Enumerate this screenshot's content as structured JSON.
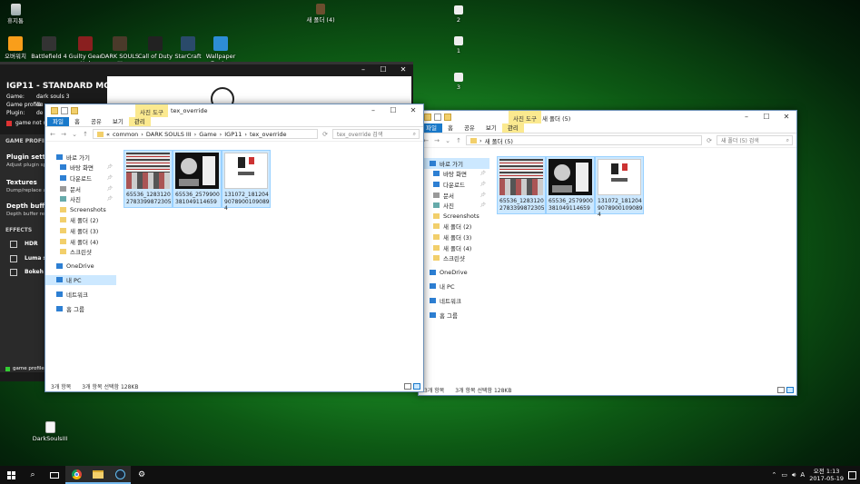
{
  "desktop": {
    "icons_top": [
      {
        "label": "휴지통",
        "icon": "recycle-bin-icon"
      },
      {
        "label": "새 폴더 (4)",
        "icon": "folder-icon"
      },
      {
        "label": "2",
        "icon": "file-icon"
      },
      {
        "label": "1",
        "icon": "file-icon"
      },
      {
        "label": "3",
        "icon": "file-icon"
      }
    ],
    "icons_row2": [
      {
        "label": "오버워치",
        "icon": "overwatch-icon",
        "color": "#f99e1a"
      },
      {
        "label": "Battlefield 4",
        "icon": "battlefield-icon",
        "color": "#333333"
      },
      {
        "label": "Guilty Gear Xrd",
        "icon": "guilty-gear-icon",
        "color": "#8a1f1f"
      },
      {
        "label": "DARK SOULS III",
        "icon": "dark-souls-icon",
        "color": "#4a3a2a"
      },
      {
        "label": "Call of Duty",
        "icon": "call-of-duty-icon",
        "color": "#222222"
      },
      {
        "label": "StarCraft",
        "icon": "starcraft-icon",
        "color": "#2a4a6a"
      },
      {
        "label": "Wallpaper Engine",
        "icon": "wallpaper-engine-icon",
        "color": "#2d8dd6"
      }
    ],
    "bottom_icon": {
      "label": "DarkSoulsIII",
      "icon": "file-icon"
    }
  },
  "igp": {
    "title": "IGP11 - STANDARD MODE",
    "game_label": "Game:",
    "game_value": "dark souls 3",
    "profile_label": "Game profile:",
    "profile_value": "de",
    "plugin_label": "Plugin:",
    "plugin_value": "de",
    "game_status": "game not run",
    "section1": "GAME PROFILE SE",
    "plugin_settings": "Plugin setting",
    "plugin_settings_sub": "Adjust plugin spec",
    "textures": "Textures",
    "textures_sub": "Dump/replace and",
    "depth": "Depth buffer",
    "depth_sub": "Depth buffer rend",
    "effects": "EFFECTS",
    "effect_items": [
      "HDR",
      "Luma s",
      "Bokeh"
    ],
    "footer": "game profile s"
  },
  "explorer_left": {
    "context_tab": "사진 도구",
    "title": "tex_override",
    "tabs": [
      "파일",
      "홈",
      "공유",
      "보기",
      "관리"
    ],
    "breadcrumb": [
      "common",
      "DARK SOULS III",
      "Game",
      "IGP11",
      "tex_override"
    ],
    "search_placeholder": "tex_override 검색",
    "nav": [
      {
        "label": "바로 가기",
        "type": "star",
        "pin": false,
        "sub": false
      },
      {
        "label": "바탕 화면",
        "type": "desktop",
        "pin": true,
        "sub": true
      },
      {
        "label": "다운로드",
        "type": "download",
        "pin": true,
        "sub": true
      },
      {
        "label": "문서",
        "type": "doc",
        "pin": true,
        "sub": true
      },
      {
        "label": "사진",
        "type": "pic",
        "pin": true,
        "sub": true
      },
      {
        "label": "Screenshots",
        "type": "folder",
        "pin": false,
        "sub": true
      },
      {
        "label": "새 폴더 (2)",
        "type": "folder",
        "pin": false,
        "sub": true
      },
      {
        "label": "새 폴더 (3)",
        "type": "folder",
        "pin": false,
        "sub": true
      },
      {
        "label": "새 폴더 (4)",
        "type": "folder",
        "pin": false,
        "sub": true
      },
      {
        "label": "스크린샷",
        "type": "folder",
        "pin": false,
        "sub": true
      },
      {
        "label": "",
        "type": "gap",
        "pin": false,
        "sub": false
      },
      {
        "label": "OneDrive",
        "type": "cloud",
        "pin": false,
        "sub": false
      },
      {
        "label": "",
        "type": "gap",
        "pin": false,
        "sub": false
      },
      {
        "label": "내 PC",
        "type": "pc",
        "pin": false,
        "sub": false,
        "selected": true
      },
      {
        "label": "",
        "type": "gap",
        "pin": false,
        "sub": false
      },
      {
        "label": "네트워크",
        "type": "net",
        "pin": false,
        "sub": false
      },
      {
        "label": "",
        "type": "gap",
        "pin": false,
        "sub": false
      },
      {
        "label": "홈 그룹",
        "type": "home",
        "pin": false,
        "sub": false
      }
    ],
    "files": [
      {
        "name": "65536_12831202783399872305",
        "line1": "65536_1283120",
        "line2": "2783399872305",
        "thumb": "strip"
      },
      {
        "name": "65536_2579900381049114659",
        "line1": "65536_2579900",
        "line2": "381049114659",
        "thumb": "circle"
      },
      {
        "name": "131072_1812049078900109089",
        "line1": "131072_181204",
        "line2": "9078900109089",
        "line3": "4",
        "thumb": "white"
      }
    ],
    "status_count": "3개 항목",
    "status_selected": "3개 항목 선택함 128KB"
  },
  "explorer_right": {
    "context_tab": "사진 도구",
    "title": "새 폴더 (5)",
    "tabs": [
      "파일",
      "홈",
      "공유",
      "보기",
      "관리"
    ],
    "breadcrumb": [
      "새 폴더 (5)"
    ],
    "search_placeholder": "새 폴더 (5) 검색",
    "nav": [
      {
        "label": "바로 가기",
        "type": "star",
        "pin": false,
        "sub": false,
        "selected": true
      },
      {
        "label": "바탕 화면",
        "type": "desktop",
        "pin": true,
        "sub": true
      },
      {
        "label": "다운로드",
        "type": "download",
        "pin": true,
        "sub": true
      },
      {
        "label": "문서",
        "type": "doc",
        "pin": true,
        "sub": true
      },
      {
        "label": "사진",
        "type": "pic",
        "pin": true,
        "sub": true
      },
      {
        "label": "Screenshots",
        "type": "folder",
        "pin": false,
        "sub": true
      },
      {
        "label": "새 폴더 (2)",
        "type": "folder",
        "pin": false,
        "sub": true
      },
      {
        "label": "새 폴더 (3)",
        "type": "folder",
        "pin": false,
        "sub": true
      },
      {
        "label": "새 폴더 (4)",
        "type": "folder",
        "pin": false,
        "sub": true
      },
      {
        "label": "스크린샷",
        "type": "folder",
        "pin": false,
        "sub": true
      },
      {
        "label": "",
        "type": "gap",
        "pin": false,
        "sub": false
      },
      {
        "label": "OneDrive",
        "type": "cloud",
        "pin": false,
        "sub": false
      },
      {
        "label": "",
        "type": "gap",
        "pin": false,
        "sub": false
      },
      {
        "label": "내 PC",
        "type": "pc",
        "pin": false,
        "sub": false
      },
      {
        "label": "",
        "type": "gap",
        "pin": false,
        "sub": false
      },
      {
        "label": "네트워크",
        "type": "net",
        "pin": false,
        "sub": false
      },
      {
        "label": "",
        "type": "gap",
        "pin": false,
        "sub": false
      },
      {
        "label": "홈 그룹",
        "type": "home",
        "pin": false,
        "sub": false
      }
    ],
    "files": [
      {
        "name": "65536_12831202783399872305",
        "line1": "65536_1283120",
        "line2": "2783399872305",
        "thumb": "strip"
      },
      {
        "name": "65536_2579900381049114659",
        "line1": "65536_2579900",
        "line2": "381049114659",
        "thumb": "circle"
      },
      {
        "name": "131072_1812049078900109089",
        "line1": "131072_181204",
        "line2": "9078900109089",
        "line3": "4",
        "thumb": "white"
      }
    ],
    "status_count": "3개 항목",
    "status_selected": "3개 항목 선택함 128KB"
  },
  "taskbar": {
    "items": [
      "start-icon",
      "search-icon",
      "task-view-icon",
      "chrome-icon",
      "file-explorer-icon",
      "steam-icon",
      "igp-icon"
    ],
    "time": "오전 1:13",
    "date": "2017-05-19",
    "ime": "A"
  }
}
